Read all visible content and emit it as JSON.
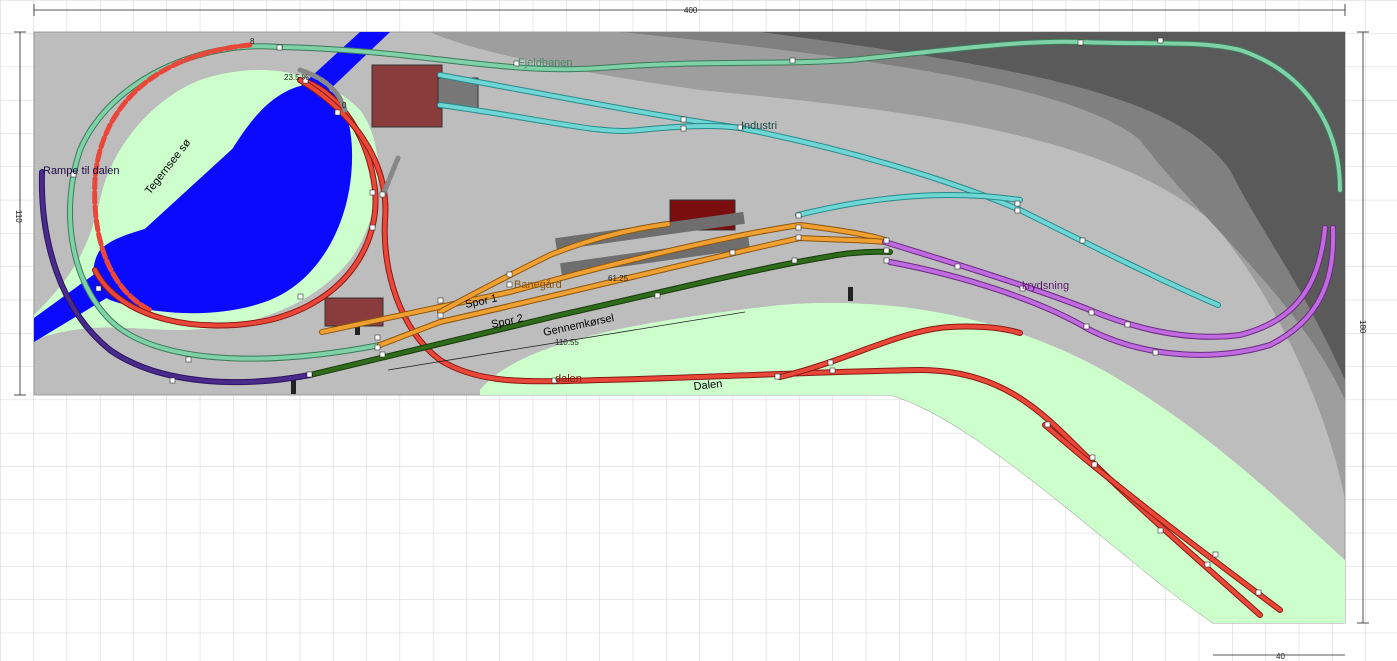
{
  "dimensions": {
    "top_width": "400",
    "left_height": "110",
    "right_height": "180",
    "bottom_right": "40"
  },
  "labels": {
    "fjeldbanen": "Fjeldbanen",
    "industri": "Industri",
    "tegernsee": "Tegernsee sø",
    "rampe": "Rampe til dalen",
    "banegard": "Banegård",
    "spor1": "Spor 1",
    "spor2": "Spor 2",
    "gennemkorsel": "Gennemkørsel",
    "krydsning": "krydsning",
    "dalen_small": "dalen",
    "dalen": "Dalen",
    "grade": "23.5 %",
    "len_8": "8",
    "len_0": "0",
    "len_6125": "61.25",
    "len_11055": "110.55"
  },
  "colors": {
    "water": "#0a0aff",
    "grass": "#ccffcc",
    "base": "#bdbdbd",
    "hill1": "#9e9e9e",
    "hill2": "#7d7d7d",
    "hill3": "#555555",
    "red_track": "#e8473a",
    "green_track": "#6fc49a",
    "cyan_track": "#5cc9c9",
    "orange_track": "#e8961e",
    "dark_green_track": "#2e6b1a",
    "purple_track": "#b84fd8",
    "indigo_track": "#4a2a8a",
    "gray_track": "#9a9a9a"
  }
}
